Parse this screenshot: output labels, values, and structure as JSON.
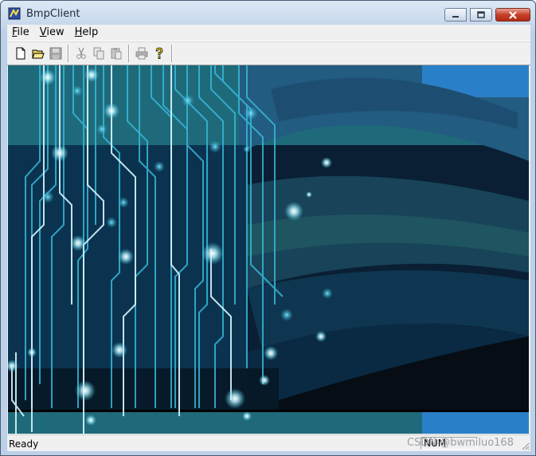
{
  "window": {
    "title": "BmpClient"
  },
  "menu": [
    {
      "label": "File",
      "accel": "F"
    },
    {
      "label": "View",
      "accel": "V"
    },
    {
      "label": "Help",
      "accel": "H"
    }
  ],
  "toolbar": {
    "buttons": [
      {
        "name": "new-file-button",
        "icon": "new-document-icon",
        "enabled": true
      },
      {
        "name": "open-file-button",
        "icon": "open-folder-icon",
        "enabled": true
      },
      {
        "name": "save-button",
        "icon": "floppy-disk-icon",
        "enabled": false
      },
      {
        "name": "cut-button",
        "icon": "scissors-icon",
        "enabled": false
      },
      {
        "name": "copy-button",
        "icon": "copy-icon",
        "enabled": false
      },
      {
        "name": "paste-button",
        "icon": "paste-icon",
        "enabled": false
      },
      {
        "name": "print-button",
        "icon": "printer-icon",
        "enabled": false
      },
      {
        "name": "help-button",
        "icon": "help-question-icon",
        "enabled": true
      }
    ]
  },
  "status": {
    "text": "Ready",
    "num_indicator": "NUM"
  },
  "watermark": "CSDN @bwmiluo168",
  "colors": {
    "circuit_line": "#3fd0e8",
    "circuit_glow": "#ffffff",
    "background_dark": "#0b2a40",
    "background_teal": "#1f6a7a"
  }
}
